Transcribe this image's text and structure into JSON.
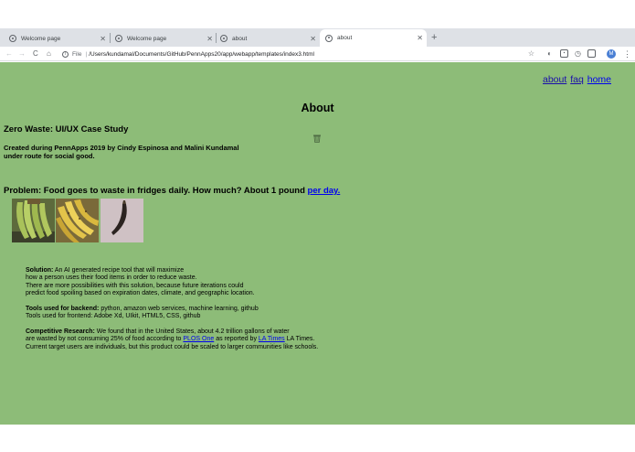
{
  "browser": {
    "tabs": [
      {
        "title": "Welcome page",
        "active": false
      },
      {
        "title": "Welcome page",
        "active": false
      },
      {
        "title": "about",
        "active": false
      },
      {
        "title": "about",
        "active": true
      }
    ],
    "file_label": "File",
    "url": "/Users/kundamal/Documents/GitHub/PennApps20/app/webapp/templates/index3.html",
    "profile_initial": "M"
  },
  "page": {
    "nav": {
      "about": "about",
      "faq": "faq",
      "home": "home"
    },
    "heading": "About",
    "case_title": "Zero Waste: UI/UX Case Study",
    "credits_line1": "Created during PennApps 2019 by Cindy Espinosa and Malini Kundamal",
    "credits_line2": "under route for social good.",
    "problem_text": "Problem: Food goes to waste in fridges daily. How much? About 1 pound ",
    "problem_link": "per day.",
    "solution": {
      "label": "Solution:",
      "line1": " An AI generated recipe tool that will maximize",
      "line2": "how a person uses their food items in order to reduce waste.",
      "line3": "There are more possibilities with this solution, because future iterations could",
      "line4": "predict food spoiling based on expiration dates, climate, and geographic location."
    },
    "tools": {
      "backend_label": "Tools used for backend:",
      "backend": " python, amazon web services, machine learning, github",
      "frontend": "Tools used for frontend: Adobe Xd, UIkit, HTML5, CSS, github"
    },
    "research": {
      "label": "Competitive Research:",
      "line1": " We found that in the United States, about 4.2 trillion gallons of water",
      "line2a": "are wasted by not consuming 25% of food according to ",
      "link1": "PLOS One",
      "line2b": " as reported by ",
      "link2": "LA Times",
      "line2c": " LA Times.",
      "line3": "Current target users are individuals, but this product could be scaled to larger communities like schools."
    }
  },
  "colors": {
    "page_background": "#8dbc78",
    "link": "#0000ee"
  }
}
